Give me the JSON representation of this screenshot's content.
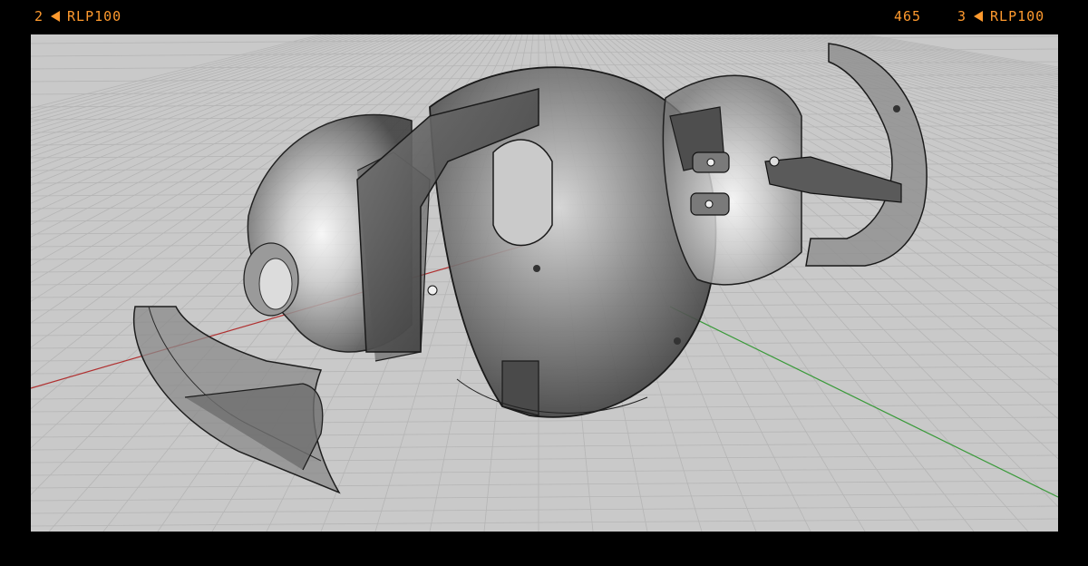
{
  "film_strip": {
    "left_frame_number": "2",
    "left_code": "RLP100",
    "right_edge_number": "465",
    "right_frame_number": "3",
    "right_code": "RLP100",
    "text_color": "#ff9a2e",
    "arrow_icon": "left-triangle-icon"
  },
  "viewport": {
    "subject": "exploded 3D sphere assembly render",
    "background_color": "#c9c9c9",
    "grid_color": "#b8b8b8",
    "x_axis_color": "#b03030",
    "y_axis_color": "#3a9a3a"
  }
}
